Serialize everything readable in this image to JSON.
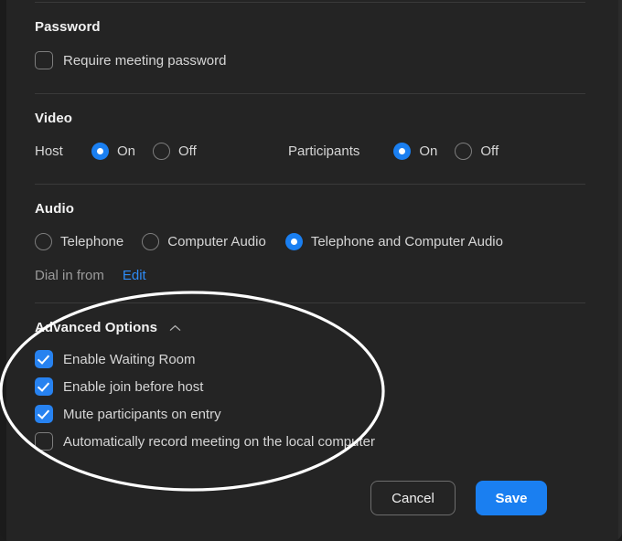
{
  "dialog": {
    "sections": {
      "password": {
        "title": "Password",
        "options": [
          {
            "label": "Require meeting password",
            "checked": false
          }
        ]
      },
      "video": {
        "title": "Video",
        "groups": [
          {
            "label": "Host",
            "options": [
              {
                "label": "On",
                "selected": true
              },
              {
                "label": "Off",
                "selected": false
              }
            ]
          },
          {
            "label": "Participants",
            "options": [
              {
                "label": "On",
                "selected": true
              },
              {
                "label": "Off",
                "selected": false
              }
            ]
          }
        ]
      },
      "audio": {
        "title": "Audio",
        "options": [
          {
            "label": "Telephone",
            "selected": false
          },
          {
            "label": "Computer Audio",
            "selected": false
          },
          {
            "label": "Telephone and Computer Audio",
            "selected": true
          }
        ],
        "dial_in_label": "Dial in from",
        "edit_link": "Edit"
      },
      "advanced": {
        "title": "Advanced Options",
        "chevron": "chevron-up-icon",
        "options": [
          {
            "label": "Enable Waiting Room",
            "checked": true
          },
          {
            "label": "Enable join before host",
            "checked": true
          },
          {
            "label": "Mute participants on entry",
            "checked": true
          },
          {
            "label": "Automatically record meeting on the local computer",
            "checked": false
          }
        ]
      }
    },
    "footer": {
      "cancel_label": "Cancel",
      "save_label": "Save"
    }
  },
  "annotation": {
    "shape": "ellipse-highlight",
    "color": "#ffffff"
  },
  "colors": {
    "accent": "#1a7ff1",
    "checkbox_on": "#2782f0",
    "link": "#2e8bf5",
    "background": "#242424",
    "divider": "#3a3a3a",
    "text_primary": "#f2f2f2",
    "text_secondary": "#d6d6d6",
    "text_muted": "#9b9b9b"
  }
}
